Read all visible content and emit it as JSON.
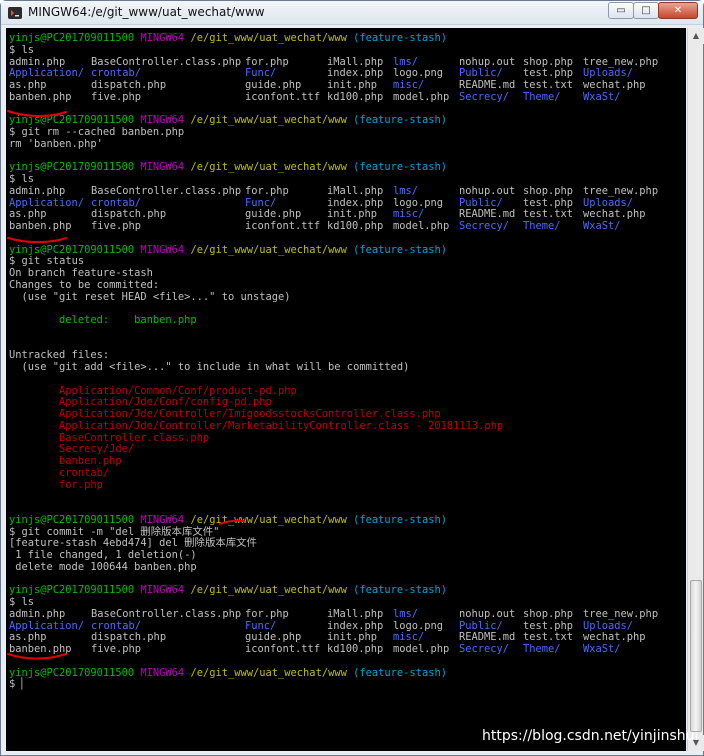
{
  "window": {
    "title": "MINGW64:/e/git_www/uat_wechat/www",
    "minimize_symbol": "▭",
    "maximize_symbol": "□",
    "close_symbol": "✕"
  },
  "prompt": {
    "user_host": "yinjs@PC201709011500",
    "shell": "MINGW64",
    "path": "/e/git_www/uat_wechat/www",
    "branch": "(feature-stash)",
    "dollar": "$"
  },
  "commands": {
    "ls": "ls",
    "git_rm": "git rm --cached banben.php",
    "git_status": "git status",
    "git_commit": "git commit -m \"del 删除版本库文件\""
  },
  "listings": [
    {
      "rows": [
        [
          "admin.php",
          "BaseController.class.php",
          "for.php",
          "iMall.php",
          "lms/",
          "nohup.out",
          "shop.php",
          "tree_new.php"
        ],
        [
          "Application/",
          "crontab/",
          "Func/",
          "index.php",
          "logo.png",
          "Public/",
          "test.php",
          "Uploads/"
        ],
        [
          "as.php",
          "dispatch.php",
          "guide.php",
          "init.php",
          "misc/",
          "README.md",
          "test.txt",
          "wechat.php"
        ],
        [
          "banben.php",
          "five.php",
          "iconfont.ttf",
          "kd100.php",
          "model.php",
          "Secrecy/",
          "Theme/",
          "WxaSt/"
        ]
      ]
    },
    {
      "rows": [
        [
          "admin.php",
          "BaseController.class.php",
          "for.php",
          "iMall.php",
          "lms/",
          "nohup.out",
          "shop.php",
          "tree_new.php"
        ],
        [
          "Application/",
          "crontab/",
          "Func/",
          "index.php",
          "logo.png",
          "Public/",
          "test.php",
          "Uploads/"
        ],
        [
          "as.php",
          "dispatch.php",
          "guide.php",
          "init.php",
          "misc/",
          "README.md",
          "test.txt",
          "wechat.php"
        ],
        [
          "banben.php",
          "five.php",
          "iconfont.ttf",
          "kd100.php",
          "model.php",
          "Secrecy/",
          "Theme/",
          "WxaSt/"
        ]
      ]
    },
    {
      "rows": [
        [
          "admin.php",
          "BaseController.class.php",
          "for.php",
          "iMall.php",
          "lms/",
          "nohup.out",
          "shop.php",
          "tree_new.php"
        ],
        [
          "Application/",
          "crontab/",
          "Func/",
          "index.php",
          "logo.png",
          "Public/",
          "test.php",
          "Uploads/"
        ],
        [
          "as.php",
          "dispatch.php",
          "guide.php",
          "init.php",
          "misc/",
          "README.md",
          "test.txt",
          "wechat.php"
        ],
        [
          "banben.php",
          "five.php",
          "iconfont.ttf",
          "kd100.php",
          "model.php",
          "Secrecy/",
          "Theme/",
          "WxaSt/"
        ]
      ]
    }
  ],
  "rm_output": "rm 'banben.php'",
  "status": {
    "on_branch": "On branch feature-stash",
    "changes_header": "Changes to be committed:",
    "unstage_hint": "  (use \"git reset HEAD <file>...\" to unstage)",
    "deleted_line": "        deleted:    banben.php",
    "untracked_header": "Untracked files:",
    "add_hint": "  (use \"git add <file>...\" to include in what will be committed)",
    "untracked_files": [
      "Application/Common/Conf/product-pd.php",
      "Application/Jde/Conf/config-pd.php",
      "Application/Jde/Controller/ImigoodsstocksController.class.php",
      "Application/Jde/Controller/MarketabilityController.class - 20181113.php",
      "BaseController.class.php",
      "Secrecy/Jde/",
      "banben.php",
      "crontab/",
      "for.php"
    ]
  },
  "commit_output": [
    "[feature-stash 4ebd474] del 删除版本库文件",
    " 1 file changed, 1 deletion(-)",
    " delete mode 100644 banben.php"
  ],
  "colors": {
    "terminal_bg": "#000000",
    "prompt_green": "#00c000",
    "shell_magenta": "#c000c0",
    "path_yellow": "#c0c000",
    "branch_cyan": "#00a6d6",
    "dir_blue": "#4a6cff",
    "untracked_red": "#c00000",
    "annotation_red": "#e00000"
  },
  "watermark": "https://blog.csdn.net/yinjinshui"
}
